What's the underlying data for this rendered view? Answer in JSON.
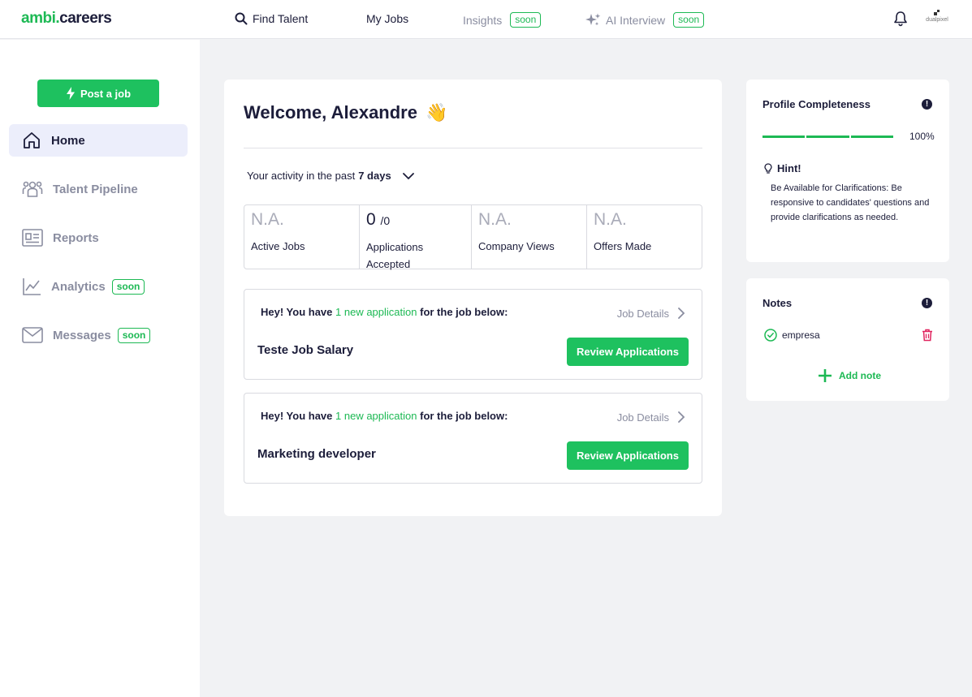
{
  "brand": {
    "name_part1": "ambi",
    "dot": ".",
    "name_part2": "careers"
  },
  "nav": {
    "find_talent": "Find Talent",
    "my_jobs": "My Jobs",
    "insights": "Insights",
    "insights_badge": "soon",
    "ai_interview": "AI Interview",
    "ai_interview_badge": "soon",
    "company_label": "dualpixel"
  },
  "sidebar": {
    "post_job": "Post a job",
    "items": [
      {
        "label": "Home",
        "active": true
      },
      {
        "label": "Talent Pipeline"
      },
      {
        "label": "Reports"
      },
      {
        "label": "Analytics",
        "badge": "soon"
      },
      {
        "label": "Messages",
        "badge": "soon"
      }
    ]
  },
  "main": {
    "welcome": "Welcome, Alexandre",
    "welcome_emoji": "👋",
    "activity_prefix": "Your activity in the past",
    "activity_period": "7 days",
    "stats": [
      {
        "value": "N.A.",
        "label": "Active Jobs"
      },
      {
        "value": "0",
        "suffix": "/0",
        "label": "Applications Accepted"
      },
      {
        "value": "N.A.",
        "label": "Company Views"
      },
      {
        "value": "N.A.",
        "label": "Offers Made"
      }
    ],
    "jobs": [
      {
        "msg_prefix": "Hey! You have",
        "msg_highlight": "1 new application",
        "msg_suffix": "for the job below:",
        "details": "Job Details",
        "title": "Teste Job Salary",
        "button": "Review Applications"
      },
      {
        "msg_prefix": "Hey! You have",
        "msg_highlight": "1 new application",
        "msg_suffix": "for the job below:",
        "details": "Job Details",
        "title": "Marketing developer",
        "button": "Review Applications"
      }
    ]
  },
  "profile": {
    "title": "Profile Completeness",
    "completeness_percent": 100,
    "percent_label": "100%",
    "hint_title": "Hint!",
    "hint_text": "Be Available for Clarifications: Be responsive to candidates' questions and provide clarifications as needed."
  },
  "notes": {
    "title": "Notes",
    "items": [
      {
        "text": "empresa"
      }
    ],
    "add_label": "Add note"
  },
  "colors": {
    "accent": "#1db954",
    "button": "#1ec15f",
    "text": "#1c1d3a",
    "muted": "#8a8da0",
    "danger": "#e0245e"
  }
}
